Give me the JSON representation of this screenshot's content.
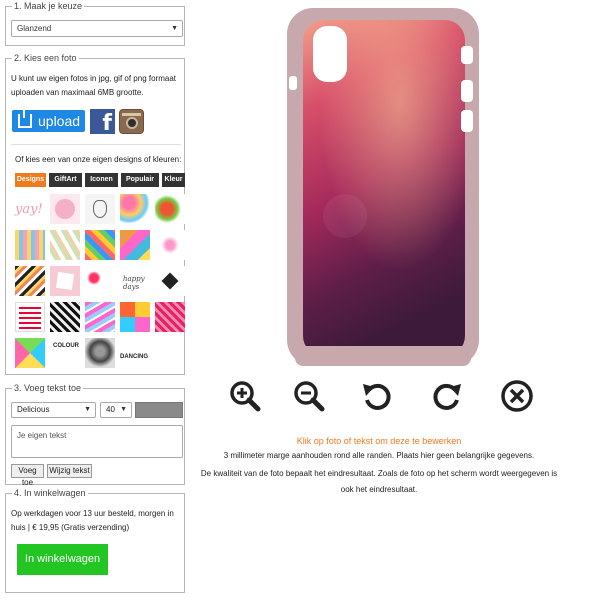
{
  "step1": {
    "legend": "1. Maak je keuze",
    "finish_select": "Glanzend"
  },
  "step2": {
    "legend": "2. Kies een foto",
    "description": "U kunt uw eigen fotos in jpg, gif of png formaat uploaden van maximaal 6MB grootte.",
    "upload_label": "upload",
    "facebook_icon": "facebook-icon",
    "instagram_icon": "instagram-icon",
    "designs_hint": "Of kies een van onze eigen designs of kleuren:",
    "tabs": [
      {
        "label": "Designs",
        "active": true
      },
      {
        "label": "GiftArt",
        "active": false
      },
      {
        "label": "Iconen",
        "active": false
      },
      {
        "label": "Populair",
        "active": false
      },
      {
        "label": "Kleur",
        "active": false
      }
    ],
    "thumbnail_texts": {
      "yay": "yay!",
      "happy_days": "happy days",
      "dancing": "DANCING",
      "colour": "COLOUR"
    }
  },
  "step3": {
    "legend": "3. Voeg tekst toe",
    "font_select": "Delicious",
    "size_select": "40",
    "text_placeholder": "Je eigen tekst",
    "add_text_label": "Voeg toe",
    "edit_text_label": "Wijzig tekst",
    "text_color": "#8a8a8a"
  },
  "step4": {
    "legend": "4. In winkelwagen",
    "shipping": "Op werkdagen voor 13 uur besteld, morgen in huis | € 19,95 (Gratis verzending)",
    "cart_label": "In winkelwagen"
  },
  "preview": {
    "edit_hint": "Klik op foto of tekst om deze te bewerken",
    "margin_info": "3 millimeter marge aanhouden rond alle randen. Plaats hier geen belangrijke gegevens.",
    "quality_info": "De kwaliteit van de foto bepaalt het eindresultaat. Zoals de foto op het scherm wordt weergegeven is ook het eindresultaat.",
    "tools": [
      "zoom-in-icon",
      "zoom-out-icon",
      "rotate-left-icon",
      "rotate-right-icon",
      "remove-icon"
    ]
  },
  "colors": {
    "accent": "#f07b1d",
    "upload_blue": "#1e88e5",
    "facebook_blue": "#3b5998",
    "cart_green": "#22c522",
    "tab_dark": "#333333"
  }
}
